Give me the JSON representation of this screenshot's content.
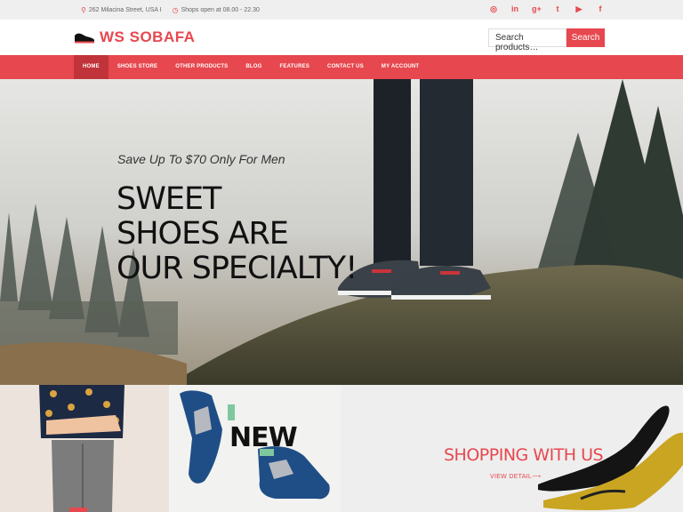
{
  "topbar": {
    "address": "262 Milacina Street, USA I",
    "hours": "Shops open at 08.00 - 22.30",
    "social_icons": [
      "instagram-icon",
      "linkedin-icon",
      "google-plus-icon",
      "twitter-icon",
      "youtube-icon",
      "facebook-icon"
    ],
    "social_glyphs": [
      "◎",
      "in",
      "g+",
      "t",
      "▶",
      "f"
    ]
  },
  "header": {
    "logo_text": "WS SOBAFA",
    "search_placeholder": "Search products…",
    "search_button": "Search"
  },
  "nav": {
    "items": [
      {
        "label": "HOME",
        "active": true
      },
      {
        "label": "SHOES STORE",
        "active": false
      },
      {
        "label": "OTHER PRODUCTS",
        "active": false
      },
      {
        "label": "BLOG",
        "active": false
      },
      {
        "label": "FEATURES",
        "active": false
      },
      {
        "label": "CONTACT US",
        "active": false
      },
      {
        "label": "MY ACCOUNT",
        "active": false
      }
    ]
  },
  "hero": {
    "subtitle": "Save Up To $70 Only For Men",
    "title_lines": [
      "SWEET",
      "SHOES ARE",
      "OUR SPECIALTY!"
    ]
  },
  "promos": {
    "new_label": "NEW",
    "shopping_title": "SHOPPING WITH US",
    "view_detail": "VIEW DETAIL⟶"
  },
  "colors": {
    "accent": "#e7474e",
    "accent_dark": "#c0333a"
  }
}
